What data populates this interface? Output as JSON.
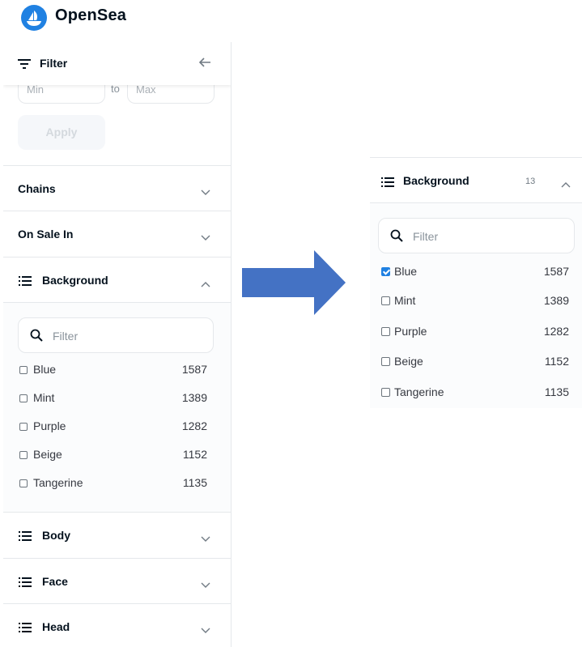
{
  "header": {
    "brand": "OpenSea"
  },
  "filter_panel": {
    "title": "Filter",
    "price": {
      "min_placeholder": "Min",
      "to_label": "to",
      "max_placeholder": "Max",
      "apply_label": "Apply"
    },
    "sections": {
      "chains": "Chains",
      "on_sale_in": "On Sale In",
      "background": "Background",
      "body": "Body",
      "face": "Face",
      "head": "Head"
    },
    "background": {
      "search_placeholder": "Filter",
      "options": [
        {
          "name": "Blue",
          "count": "1587",
          "checked": false
        },
        {
          "name": "Mint",
          "count": "1389",
          "checked": false
        },
        {
          "name": "Purple",
          "count": "1282",
          "checked": false
        },
        {
          "name": "Beige",
          "count": "1152",
          "checked": false
        },
        {
          "name": "Tangerine",
          "count": "1135",
          "checked": false
        }
      ]
    }
  },
  "zoomed_panel": {
    "title": "Background",
    "count": "13",
    "search_placeholder": "Filter",
    "options": [
      {
        "name": "Blue",
        "count": "1587",
        "checked": true
      },
      {
        "name": "Mint",
        "count": "1389",
        "checked": false
      },
      {
        "name": "Purple",
        "count": "1282",
        "checked": false
      },
      {
        "name": "Beige",
        "count": "1152",
        "checked": false
      },
      {
        "name": "Tangerine",
        "count": "1135",
        "checked": false
      }
    ]
  },
  "colors": {
    "accent": "#2081e2",
    "arrow": "#4472c4",
    "text": "#04111d",
    "border": "#e5e8eb"
  },
  "icons": [
    "opensea-logo-icon",
    "filter-lines-icon",
    "arrow-left-icon",
    "list-icon",
    "chevron-down-icon",
    "chevron-up-icon",
    "search-icon",
    "right-arrow-icon"
  ]
}
